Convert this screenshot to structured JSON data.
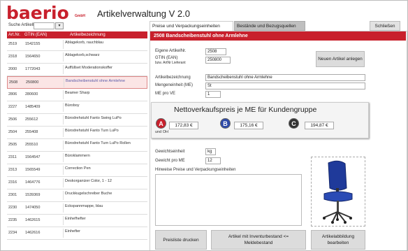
{
  "app": {
    "logo_text": "baerio",
    "logo_sub": "GmbH",
    "title": "Artikelverwaltung V 2.0"
  },
  "search": {
    "label": "Suche ArtikelNr:",
    "value": "",
    "dropdown_icon": "▾"
  },
  "list": {
    "headers": {
      "nr": "Art.Nr.",
      "gtin": "GTIN (EAN)",
      "name": "Artikelbezeichnung"
    },
    "selected_marker": "▶",
    "rows": [
      {
        "nr": "2519",
        "gtin": "1542155",
        "name": "Ablagekorb, rauchblau"
      },
      {
        "nr": "2318",
        "gtin": "1564650",
        "name": "Ablagekorb,schwarz"
      },
      {
        "nr": "2000",
        "gtin": "1772043",
        "name": "Auffüllset Moderationskoffer"
      },
      {
        "nr": "2508",
        "gtin": "250800",
        "name": "Bandscheibenstuhl ohne Armlehne",
        "selected": true
      },
      {
        "nr": "2806",
        "gtin": "280600",
        "name": "Beamer Sharp"
      },
      {
        "nr": "2227",
        "gtin": "1485409",
        "name": "Büroboy"
      },
      {
        "nr": "2506",
        "gtin": "255612",
        "name": "Bürodrehstuhl Fanto Swing LuPo"
      },
      {
        "nr": "2504",
        "gtin": "255408",
        "name": "Bürodrehstuhl Fanto Turn LuPo"
      },
      {
        "nr": "2505",
        "gtin": "255510",
        "name": "Bürodrehstuhl Fanto Turn LuPo Rollen"
      },
      {
        "nr": "2311",
        "gtin": "1564547",
        "name": "Büroklammern"
      },
      {
        "nr": "2313",
        "gtin": "1565549",
        "name": "Correction Pen"
      },
      {
        "nr": "2316",
        "gtin": "1464776",
        "name": "Deskorganizer Color, 1 - 12"
      },
      {
        "nr": "2301",
        "gtin": "1539369",
        "name": "Druckkugelschreiber Buche"
      },
      {
        "nr": "2230",
        "gtin": "1474050",
        "name": "Eckspannmappe, blau"
      },
      {
        "nr": "2235",
        "gtin": "1462615",
        "name": "Einhefhefter"
      },
      {
        "nr": "2234",
        "gtin": "1462616",
        "name": "Einhefter"
      }
    ]
  },
  "tabs": {
    "active": "Preise und Verpackungseinheiten",
    "inactive": "Bestände und Bezugsquellen"
  },
  "close_button": "Schließen",
  "detail": {
    "title": "2508  Bandscheibenstuhl ohne Armlehne",
    "eigene_artnr_label": "Eigene ArtikelNr.",
    "eigene_artnr_value": "2508",
    "gtin_label": "GTIN (EAN)",
    "gtin_sub_label": "bzw. ArtNr Lieferant",
    "gtin_value": "250800",
    "new_article_button": "Neuen Artikel anlegen",
    "bezeichnung_label": "Artikelbezeichnung",
    "bezeichnung_value": "Bandscheibenstuhl ohne Armlehne",
    "mengeneinheit_label": "Mengeneinheit (ME)",
    "mengeneinheit_value": "St",
    "me_pro_ve_label": "ME pro VE",
    "me_pro_ve_value": "1",
    "price_title": "Nettoverkaufspreis je ME für Kundengruppe",
    "group_a": "A",
    "group_b": "B",
    "group_c": "C",
    "price_a": "172,83 €",
    "price_b": "175,16 €",
    "price_c": "194,87 €",
    "price_note": "und OH",
    "gewichtseinheit_label": "Gewichtseinheit",
    "gewichtseinheit_value": "kg",
    "gewicht_label": "Gewicht pro ME",
    "gewicht_value": "12",
    "hinweise_label": "Hinweise Preise und Verpackungseinheiten",
    "hinweise_value": ""
  },
  "buttons": {
    "preisliste": "Preisliste drucken",
    "inventur": "Artikel mit Inventurbestand <= Meldebestand",
    "abbildung": "Artikelabbildung bearbeiten"
  },
  "colors": {
    "brand": "#c8202c",
    "group_b": "#2e4aa8",
    "group_c": "#333333"
  }
}
